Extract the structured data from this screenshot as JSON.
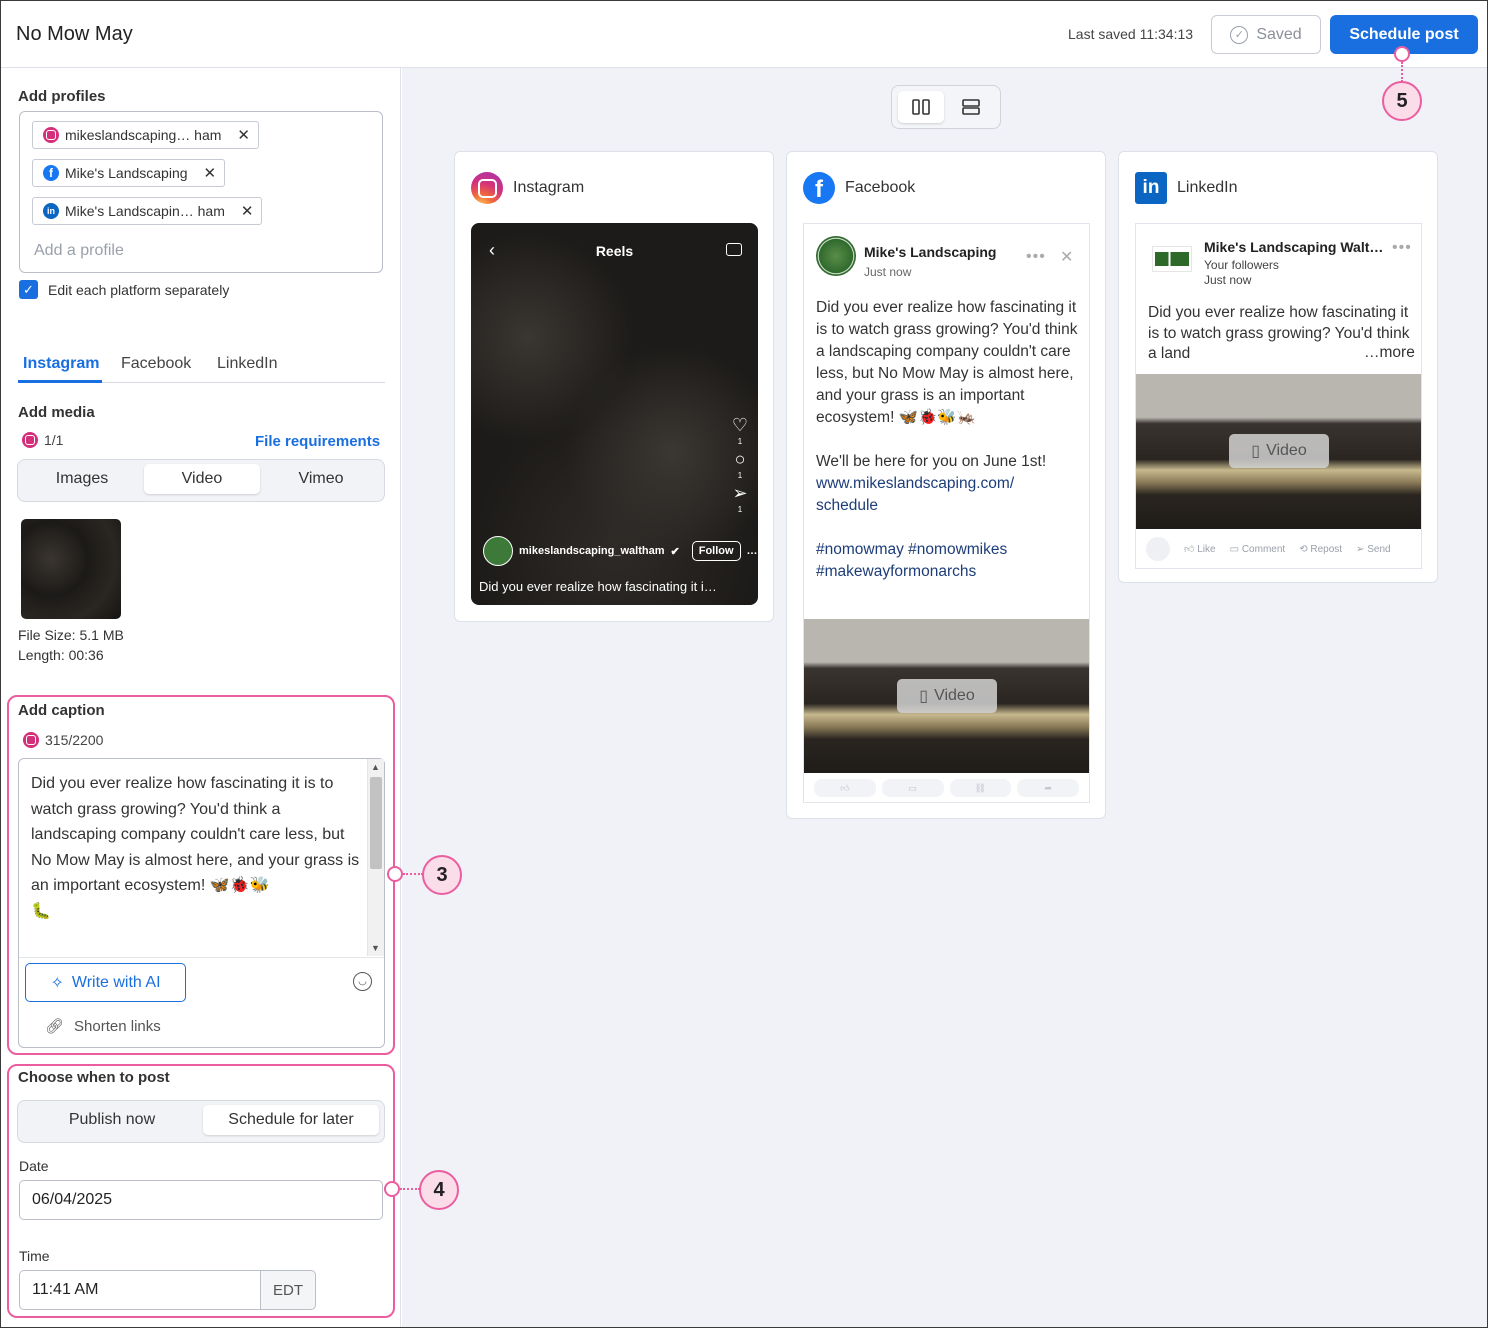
{
  "header": {
    "title": "No Mow May",
    "last_saved": "Last saved 11:34:13",
    "saved_label": "Saved",
    "schedule_label": "Schedule post"
  },
  "profiles": {
    "label": "Add profiles",
    "chips": [
      {
        "platform": "instagram",
        "name": "mikeslandscaping… ham"
      },
      {
        "platform": "facebook",
        "name": "Mike's Landscaping"
      },
      {
        "platform": "linkedin",
        "name": "Mike's Landscapin… ham"
      }
    ],
    "placeholder": "Add a profile",
    "edit_separately": "Edit each platform separately"
  },
  "platform_tabs": [
    "Instagram",
    "Facebook",
    "LinkedIn"
  ],
  "media": {
    "label": "Add media",
    "count": "1/1",
    "file_requirements": "File requirements",
    "segments": [
      "Images",
      "Video",
      "Vimeo"
    ],
    "file_size": "File Size: 5.1 MB",
    "length": "Length: 00:36"
  },
  "caption": {
    "label": "Add caption",
    "count": "315/2200",
    "text": "Did you ever realize how fascinating it is to watch grass growing? You'd think a landscaping company couldn't care less, but No Mow May is almost here, and your grass is an important ecosystem! 🦋🐞🐝\n🐛",
    "write_ai": "Write with AI",
    "shorten_links": "Shorten links"
  },
  "when": {
    "label": "Choose when to post",
    "options": [
      "Publish now",
      "Schedule for later"
    ],
    "date_label": "Date",
    "date": "06/04/2025",
    "time_label": "Time",
    "time": "11:41 AM",
    "timezone": "EDT"
  },
  "previews": {
    "instagram": {
      "title": "Instagram",
      "reels": "Reels",
      "user": "mikeslandscaping_waltham",
      "follow": "Follow",
      "caption": "Did you ever realize how fascinating it is to watch grass growing?",
      "counts": [
        "1",
        "1",
        "1"
      ]
    },
    "facebook": {
      "title": "Facebook",
      "name": "Mike's Landscaping",
      "time": "Just now",
      "text1": "Did you ever realize how fascinating it is to watch grass growing? You'd think a landscaping company couldn't care less, but No Mow May is almost here, and your grass is an important ecosystem! 🦋🐞🐝🦗",
      "text2": "We'll be here for you on June 1st!",
      "link": "www.mikeslandscaping.com/\nschedule",
      "hashtags": "#nomowmay #nomowmikes #makewayformonarchs",
      "video": "Video"
    },
    "linkedin": {
      "title": "LinkedIn",
      "name": "Mike's Landscaping Walt…",
      "followers": "Your followers",
      "time": "Just now",
      "text": "Did you ever realize how fascinating it is to watch grass growing? You'd think a land",
      "more": "…more",
      "video": "Video",
      "actions": [
        "Like",
        "Comment",
        "Repost",
        "Send"
      ]
    }
  },
  "callouts": [
    "3",
    "4",
    "5"
  ],
  "colors": {
    "accent": "#1a6fe0",
    "highlight": "#ea5e9f"
  }
}
